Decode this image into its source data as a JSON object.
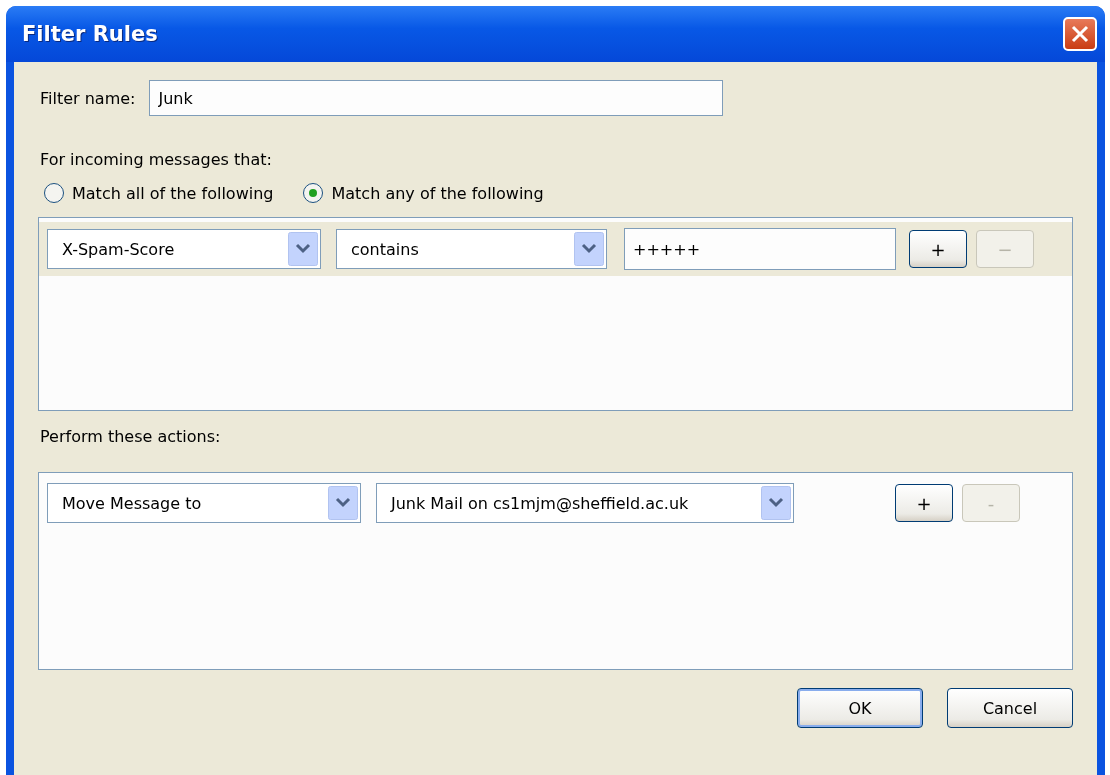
{
  "window": {
    "title": "Filter Rules"
  },
  "filter_name": {
    "label": "Filter name:",
    "value": "Junk"
  },
  "criteria": {
    "label": "For incoming messages that:",
    "match_options": [
      {
        "label": "Match all of the following",
        "selected": false
      },
      {
        "label": "Match any of the following",
        "selected": true
      }
    ],
    "rules": [
      {
        "field": "X-Spam-Score",
        "operator": "contains",
        "value": "+++++",
        "add_button": "+",
        "remove_button": "−",
        "remove_disabled": true,
        "selected": true
      }
    ]
  },
  "actions": {
    "label": "Perform these actions:",
    "rows": [
      {
        "action": "Move Message to",
        "target": "Junk Mail on cs1mjm@sheffield.ac.uk",
        "add_button": "+",
        "remove_button": "-",
        "remove_disabled": true,
        "selected": false
      }
    ]
  },
  "buttons": [
    {
      "label": "OK",
      "default": true
    },
    {
      "label": "Cancel",
      "default": false
    }
  ]
}
